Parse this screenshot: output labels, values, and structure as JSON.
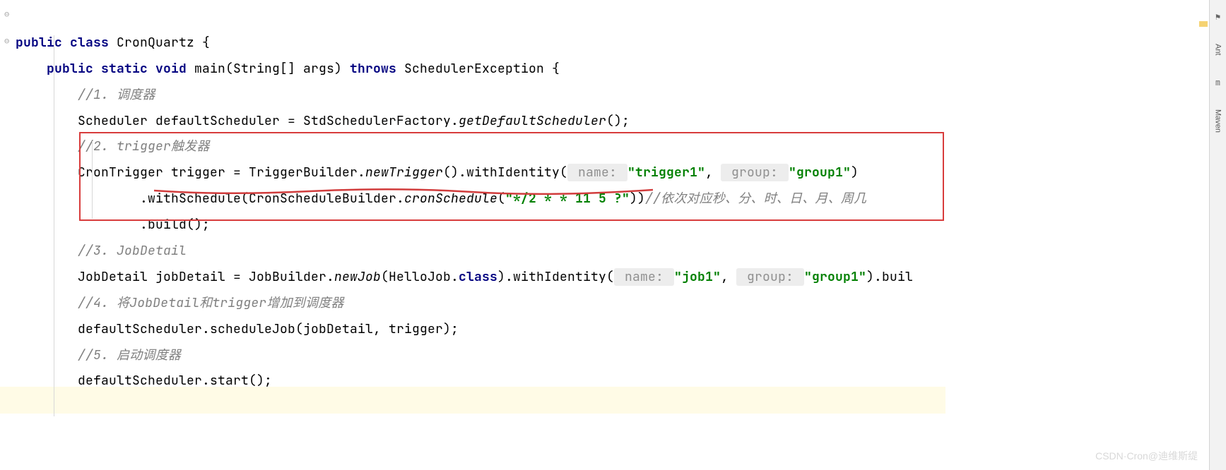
{
  "sidebar": {
    "tabs": [
      "Ant",
      "Maven"
    ]
  },
  "code": {
    "class_kw": "public class",
    "class_name": "CronQuartz",
    "main_kw": "public static void",
    "main_name": "main",
    "main_params": "(String[] args)",
    "throws_kw": "throws",
    "exception": "SchedulerException",
    "c1": "//1. 调度器",
    "l1": "Scheduler defaultScheduler = StdSchedulerFactory.",
    "l1b": "getDefaultScheduler",
    "l1c": "();",
    "c2": "//2. trigger触发器",
    "l2a": "CronTrigger trigger = TriggerBuilder.",
    "l2b": "newTrigger",
    "l2c": "().withIdentity(",
    "hint_name": " name: ",
    "str_trigger1": "\"trigger1\"",
    "comma1": ", ",
    "hint_group": " group: ",
    "str_group1": "\"group1\"",
    "l2d": ")",
    "l3a": ".withSchedule(CronScheduleBuilder.",
    "l3b": "cronSchedule",
    "l3c": "(",
    "str_cron": "\"*/2 * * 11 5 ?\"",
    "l3d": "))",
    "c3": "//依次对应秒、分、时、日、月、周几",
    "l4": ".build();",
    "c4": "//3. JobDetail",
    "l5a": "JobDetail jobDetail = JobBuilder.",
    "l5b": "newJob",
    "l5c": "(HelloJob.",
    "class_kw2": "class",
    "l5d": ").withIdentity(",
    "str_job1": "\"job1\"",
    "str_group1b": "\"group1\"",
    "l5e": ").buil",
    "c5": "//4. 将JobDetail和trigger增加到调度器",
    "l6": "defaultScheduler.scheduleJob(jobDetail, trigger);",
    "c6": "//5. 启动调度器",
    "l7": "defaultScheduler.start();"
  },
  "watermark": "CSDN·Cron@迪维斯缇"
}
